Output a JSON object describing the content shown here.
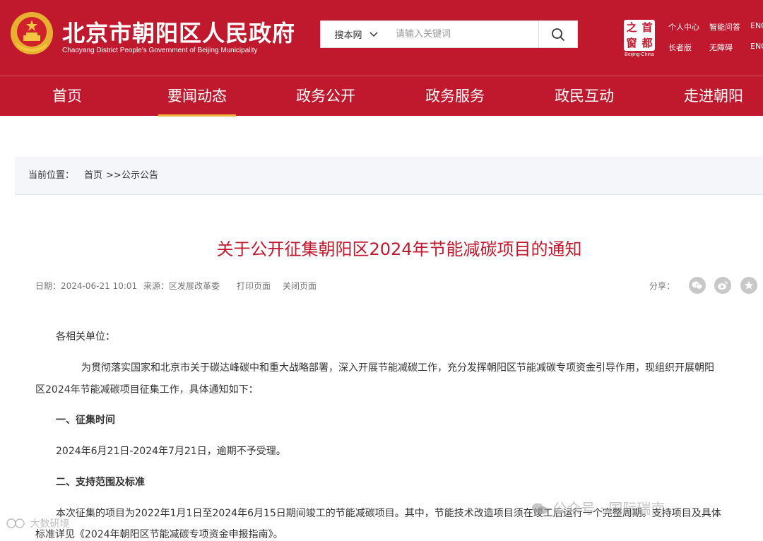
{
  "header": {
    "site_title": "北京市朝阳区人民政府",
    "site_subtitle": "Chaoyang District People's Government of Beijing Municipality",
    "search_scope": "搜本网",
    "search_placeholder": "请输入关键词",
    "capital_chars": [
      "首",
      "之",
      "都",
      "窗"
    ],
    "capital_caption": "Beijing-China",
    "util_links": [
      "个人中心",
      "智能问答",
      "ENG",
      "长者版",
      "无障碍",
      "ENG"
    ]
  },
  "nav": {
    "items": [
      "首页",
      "要闻动态",
      "政务公开",
      "政务服务",
      "政民互动",
      "走进朝阳"
    ],
    "active": "要闻动态"
  },
  "breadcrumb": {
    "label": "当前位置：",
    "home": "首页",
    "sep": ">>",
    "current": "公示公告"
  },
  "article": {
    "title": "关于公开征集朝阳区2024年节能减碳项目的通知",
    "date": "日期：2024-06-21 10:01",
    "source": "来源：区发展改革委",
    "print": "打印页面",
    "close": "关闭页面",
    "share_label": "分享：",
    "salutation": "各相关单位：",
    "intro_line1": "为贯彻落实国家和北京市关于碳达峰碳中和重大战略部署，深入开展节能减碳工作，充分发挥朝阳区节能减碳专项资金引导作用，现组织开展朝阳",
    "intro_line2": "区2024年节能减碳项目征集工作，具体通知如下：",
    "heading1": "一、征集时间",
    "time_text": "2024年6月21日-2024年7月21日，逾期不予受理。",
    "heading2": "二、支持范围及标准",
    "scope_line1": "本次征集的项目为2022年1月1日至2024年6月15日期间竣工的节能减碳项目。其中，节能技术改造项目须在竣工后运行一个完整周期。支持项目及具体",
    "scope_line2": "标准详见《2024年朝阳区节能减碳专项资金申报指南》。"
  },
  "watermarks": {
    "wechat": "公众号 · 国际瑞南",
    "corner": "大数研境"
  },
  "colors": {
    "brand_red": "#c0192d",
    "nav_active": "#f1b43a"
  }
}
